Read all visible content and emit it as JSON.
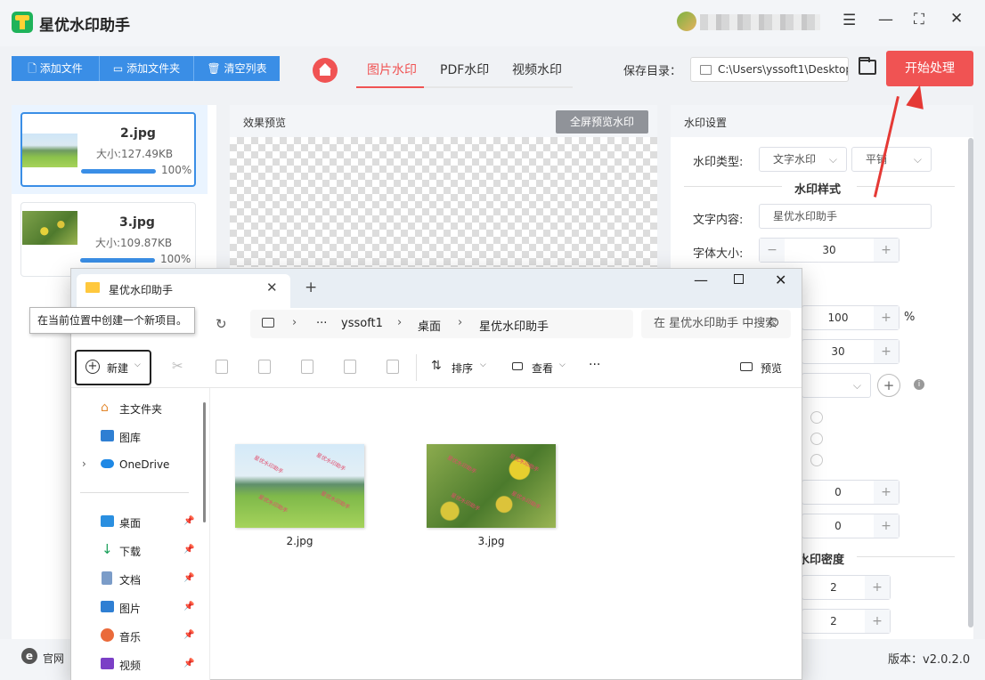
{
  "app": {
    "title": "星优水印助手",
    "version": "版本：v2.0.2.0"
  },
  "toolbar": {
    "add_file": "添加文件",
    "add_folder": "添加文件夹",
    "clear_list": "清空列表"
  },
  "tabs": [
    {
      "label": "图片水印",
      "active": true
    },
    {
      "label": "PDF水印"
    },
    {
      "label": "视频水印"
    }
  ],
  "save": {
    "label": "保存目录：",
    "path": "C:\\Users\\yssoft1\\Desktop"
  },
  "start_button": "开始处理",
  "files": [
    {
      "name": "2.jpg",
      "size": "大小:127.49KB",
      "progress": "100%",
      "progress_value": 100,
      "selected": true
    },
    {
      "name": "3.jpg",
      "size": "大小:109.87KB",
      "progress": "100%",
      "progress_value": 100
    }
  ],
  "preview": {
    "title": "效果预览",
    "fullscreen_button": "全屏预览水印"
  },
  "settings": {
    "title": "水印设置",
    "type_label": "水印类型:",
    "type_value": "文字水印",
    "layout_value": "平铺",
    "style_heading": "水印样式",
    "text_label": "文字内容:",
    "text_value": "星优水印助手",
    "font_size_label": "字体大小:",
    "font_size_value": "30",
    "opacity_value": "100",
    "opacity_unit": "%",
    "rotation_value": "30",
    "offset_x": "0",
    "offset_y": "0",
    "density_heading": "水印密度",
    "density_x": "2",
    "density_y": "2"
  },
  "bottom": {
    "site_label": "官网",
    "site_icon": "e"
  },
  "explorer": {
    "tab_title": "星优水印助手",
    "tooltip": "在当前位置中创建一个新项目。",
    "breadcrumb": [
      "yssoft1",
      "桌面",
      "星优水印助手"
    ],
    "breadcrumb_more": "···",
    "search_placeholder": "在 星优水印助手 中搜索",
    "commands": {
      "new": "新建",
      "sort": "排序",
      "view": "查看",
      "more": "···",
      "preview": "预览"
    },
    "nav": [
      {
        "label": "主文件夹"
      },
      {
        "label": "图库"
      },
      {
        "label": "OneDrive"
      },
      {
        "label": "桌面"
      },
      {
        "label": "下载"
      },
      {
        "label": "文档"
      },
      {
        "label": "图片"
      },
      {
        "label": "音乐"
      },
      {
        "label": "视频"
      }
    ],
    "files": [
      {
        "name": "2.jpg"
      },
      {
        "name": "3.jpg"
      }
    ],
    "watermark_text": "星优水印助手"
  }
}
